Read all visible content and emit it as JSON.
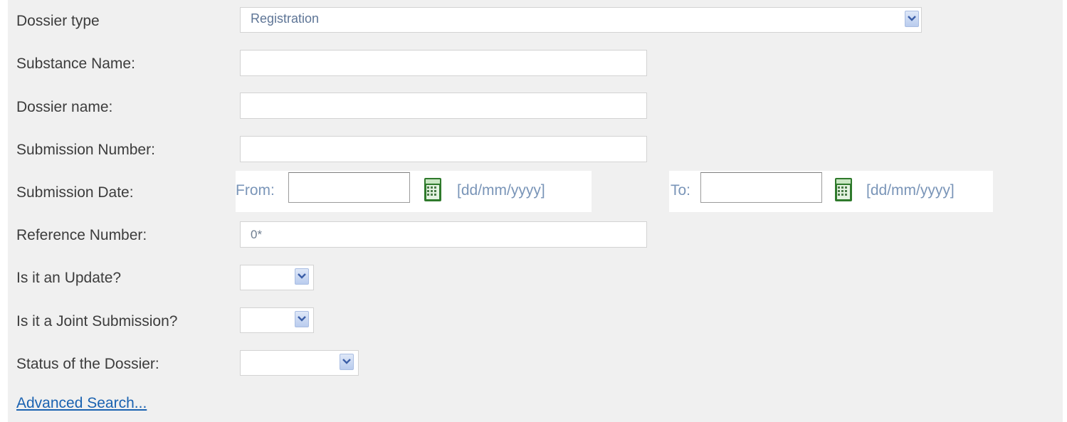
{
  "form": {
    "dossier_type": {
      "label": "Dossier type",
      "value": "Registration"
    },
    "substance_name": {
      "label": "Substance Name:",
      "value": ""
    },
    "dossier_name": {
      "label": "Dossier name:",
      "value": ""
    },
    "submission_number": {
      "label": "Submission Number:",
      "value": ""
    },
    "submission_date": {
      "label": "Submission Date:",
      "from_label": "From:",
      "from_value": "",
      "from_format": "[dd/mm/yyyy]",
      "to_label": "To:",
      "to_value": "",
      "to_format": "[dd/mm/yyyy]"
    },
    "reference_number": {
      "label": "Reference Number:",
      "value": "0*"
    },
    "is_update": {
      "label": "Is it an Update?",
      "value": ""
    },
    "is_joint": {
      "label": "Is it a Joint Submission?",
      "value": ""
    },
    "status": {
      "label": "Status of the Dossier:",
      "value": ""
    }
  },
  "advanced_search_link": "Advanced Search...",
  "icons": {
    "calendar": "calendar-icon",
    "dropdown": "chevron-down-icon"
  },
  "colors": {
    "background": "#f0f0f0",
    "label_text": "#3c3c3c",
    "field_text": "#5e7596",
    "link": "#1a62b1",
    "calendar_green": "#3f8a3b"
  }
}
